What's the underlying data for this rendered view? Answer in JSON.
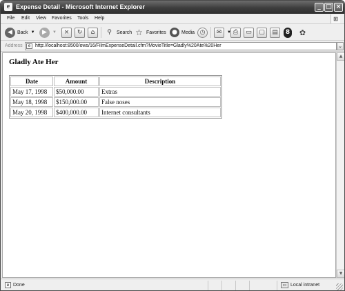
{
  "window": {
    "title": "Expense Detail - Microsoft Internet Explorer"
  },
  "menu": [
    "File",
    "Edit",
    "View",
    "Favorites",
    "Tools",
    "Help"
  ],
  "toolbar": {
    "back_label": "Back",
    "search_label": "Search",
    "favorites_label": "Favorites",
    "media_label": "Media"
  },
  "address": {
    "label": "Address",
    "url": "http://localhost:8500/ows/16/FilmExpenseDetail.cfm?MovieTitle=Gladly%20Ate%20Her"
  },
  "page": {
    "heading": "Gladly Ate Her",
    "table": {
      "headers": [
        "Date",
        "Amount",
        "Description"
      ],
      "rows": [
        [
          "May 17, 1998",
          "$50,000.00",
          "Extras"
        ],
        [
          "May 18, 1998",
          "$150,000.00",
          "False noses"
        ],
        [
          "May 20, 1998",
          "$400,000.00",
          "Internet consultants"
        ]
      ]
    }
  },
  "status": {
    "text": "Done",
    "zone": "Local intranet"
  },
  "icons": [
    "ie-logo-icon",
    "minimize-icon",
    "maximize-icon",
    "close-icon",
    "back-arrow-icon",
    "forward-arrow-icon",
    "stop-icon",
    "refresh-icon",
    "home-icon",
    "search-icon",
    "favorites-star-icon",
    "media-icon",
    "history-icon",
    "mail-icon",
    "print-icon",
    "edit-icon",
    "discuss-icon",
    "research-icon",
    "messenger-icon",
    "page-icon",
    "intranet-zone-icon"
  ]
}
